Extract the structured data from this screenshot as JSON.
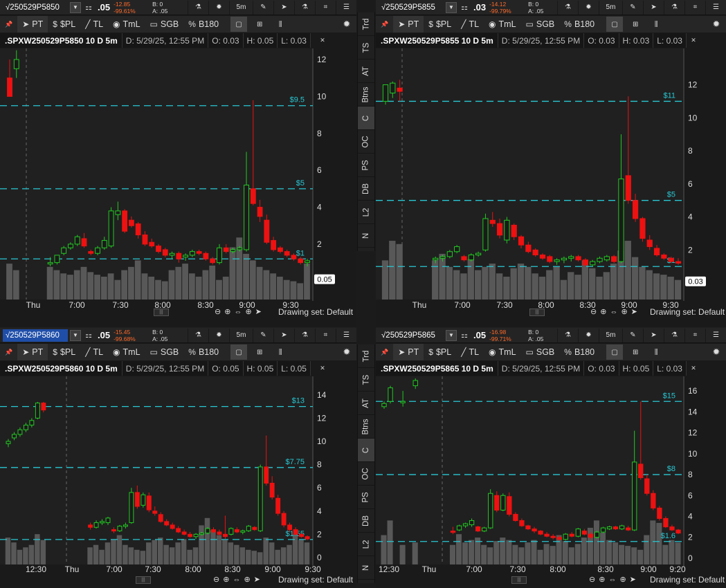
{
  "toolbar_common": {
    "b_label": "B:",
    "a_label": "A:",
    "timeframe": "5m",
    "tools": [
      {
        "key": "pin",
        "label": "",
        "icon": "pin-icon"
      },
      {
        "key": "pt",
        "label": "PT",
        "icon": "pointer-icon"
      },
      {
        "key": "pl",
        "label": "$PL",
        "icon": "dollar-pl-icon"
      },
      {
        "key": "tl",
        "label": "TL",
        "icon": "trendline-icon"
      },
      {
        "key": "tml",
        "label": "TmL",
        "icon": "timeline-icon"
      },
      {
        "key": "sgb",
        "label": "SGB",
        "icon": "sgb-icon"
      },
      {
        "key": "b180",
        "label": "B180",
        "icon": "percent-icon"
      }
    ],
    "drawing_set": "Drawing set: Default",
    "colors": {
      "up": "#22c922",
      "down": "#ee1111",
      "volume": "#585858",
      "level_line": "#28c8d4",
      "axis_text": "#dddddd",
      "price_box": "#ffffff"
    }
  },
  "side_nav_top": [
    "Trd",
    "TS",
    "AT",
    "Btns",
    "C",
    "OC",
    "PS",
    "DB",
    "L2",
    "N"
  ],
  "side_nav_bottom": [
    "Trd",
    "TS",
    "AT",
    "Btns",
    "C",
    "OC",
    "PS",
    "DB",
    "L2",
    "N"
  ],
  "side_nav_active": "C",
  "panes": [
    {
      "symbol": "√250529P5850",
      "price": ".05",
      "chg": "-12.85",
      "chg_pct": "-99.61%",
      "bid": "0",
      "ask": ".05",
      "selected": false,
      "chart_symbol": ".SPXW250529P5850 10 D 5m",
      "date": "D: 5/29/25, 12:55 PM",
      "open": "O: 0.03",
      "high": "H: 0.05",
      "low": "L: 0.03",
      "last_price_tag": "0.05",
      "chart_data": {
        "type": "candlestick",
        "y_ticks": [
          "12",
          "10",
          "8",
          "6",
          "4",
          "2"
        ],
        "x_labels": [
          "Thu",
          "7:00",
          "7:30",
          "8:00",
          "8:30",
          "9:00",
          "9:30"
        ],
        "levels": [
          {
            "label": "$9.5",
            "value": 9.5
          },
          {
            "label": "$5",
            "value": 5
          },
          {
            "label": "$1",
            "value": 1.2
          }
        ]
      }
    },
    {
      "symbol": "√250529P5855",
      "price": ".03",
      "chg": "-14.12",
      "chg_pct": "-99.79%",
      "bid": "0",
      "ask": ".05",
      "selected": false,
      "chart_symbol": ".SPXW250529P5855 10 D 5m",
      "date": "D: 5/29/25, 12:55 PM",
      "open": "O: 0.03",
      "high": "H: 0.03",
      "low": "L: 0.03",
      "last_price_tag": "0.03",
      "chart_data": {
        "type": "candlestick",
        "y_ticks": [
          "12",
          "10",
          "8",
          "6",
          "4",
          "2"
        ],
        "x_labels": [
          "Thu",
          "7:00",
          "7:30",
          "8:00",
          "8:30",
          "9:00",
          "9:30"
        ],
        "levels": [
          {
            "label": "$11",
            "value": 11
          },
          {
            "label": "$5",
            "value": 5
          },
          {
            "label": "$1",
            "value": 1
          }
        ]
      }
    },
    {
      "symbol": "√250529P5860",
      "price": ".05",
      "chg": "-15.45",
      "chg_pct": "-99.68%",
      "bid": "0",
      "ask": ".05",
      "selected": true,
      "chart_symbol": ".SPXW250529P5860 10 D 5m",
      "date": "D: 5/29/25, 12:55 PM",
      "open": "O: 0.05",
      "high": "H: 0.05",
      "low": "L: 0.05",
      "last_price_tag": "",
      "chart_data": {
        "type": "candlestick",
        "y_ticks": [
          "14",
          "12",
          "10",
          "8",
          "6",
          "4",
          "2",
          "0"
        ],
        "x_labels": [
          "12:30",
          "Thu",
          "7:00",
          "7:30",
          "8:00",
          "8:30",
          "9:00",
          "9:30"
        ],
        "levels": [
          {
            "label": "$13",
            "value": 13
          },
          {
            "label": "$7.75",
            "value": 7.75
          },
          {
            "label": "$1.55",
            "value": 1.55
          }
        ]
      }
    },
    {
      "symbol": "√250529P5865",
      "price": ".05",
      "chg": "-16.98",
      "chg_pct": "-99.71%",
      "bid": "0",
      "ask": ".05",
      "selected": false,
      "chart_symbol": ".SPXW250529P5865 10 D 5m",
      "date": "D: 5/29/25, 12:55 PM",
      "open": "O: 0.03",
      "high": "H: 0.05",
      "low": "L: 0.03",
      "last_price_tag": "",
      "chart_data": {
        "type": "candlestick",
        "y_ticks": [
          "16",
          "14",
          "12",
          "10",
          "8",
          "6",
          "4",
          "2",
          "0"
        ],
        "x_labels": [
          "12:30",
          "Thu",
          "7:00",
          "7:30",
          "8:00",
          "8:30",
          "9:00",
          "9:20"
        ],
        "levels": [
          {
            "label": "$15",
            "value": 15
          },
          {
            "label": "$8",
            "value": 8
          },
          {
            "label": "$1.6",
            "value": 1.6
          }
        ]
      }
    }
  ]
}
